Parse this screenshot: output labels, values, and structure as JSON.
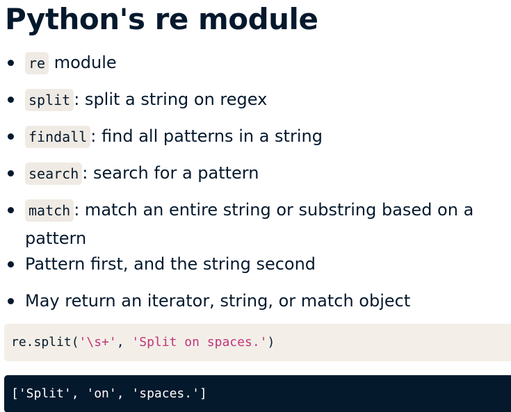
{
  "slide": {
    "title": "Python's re module"
  },
  "bullets": [
    {
      "code": "re",
      "text": " module"
    },
    {
      "code": "split",
      "text": ": split a string on regex"
    },
    {
      "code": "findall",
      "text": ": find all patterns in a string"
    },
    {
      "code": "search",
      "text": ": search for a pattern"
    },
    {
      "code": "match",
      "text": ": match an entire string or substring based on a pattern"
    },
    {
      "text": "Pattern first, and the string second"
    },
    {
      "text": "May return an iterator, string, or match object"
    }
  ],
  "code_input": {
    "func": "re.split(",
    "arg1": "'\\s+'",
    "sep": ", ",
    "arg2": "'Split on spaces.'",
    "close": ")"
  },
  "code_output": {
    "text": "['Split', 'on', 'spaces.']"
  },
  "colors": {
    "text": "#05192d",
    "code_bg": "#efeae3",
    "output_bg": "#05192d",
    "string": "#c1347a"
  }
}
